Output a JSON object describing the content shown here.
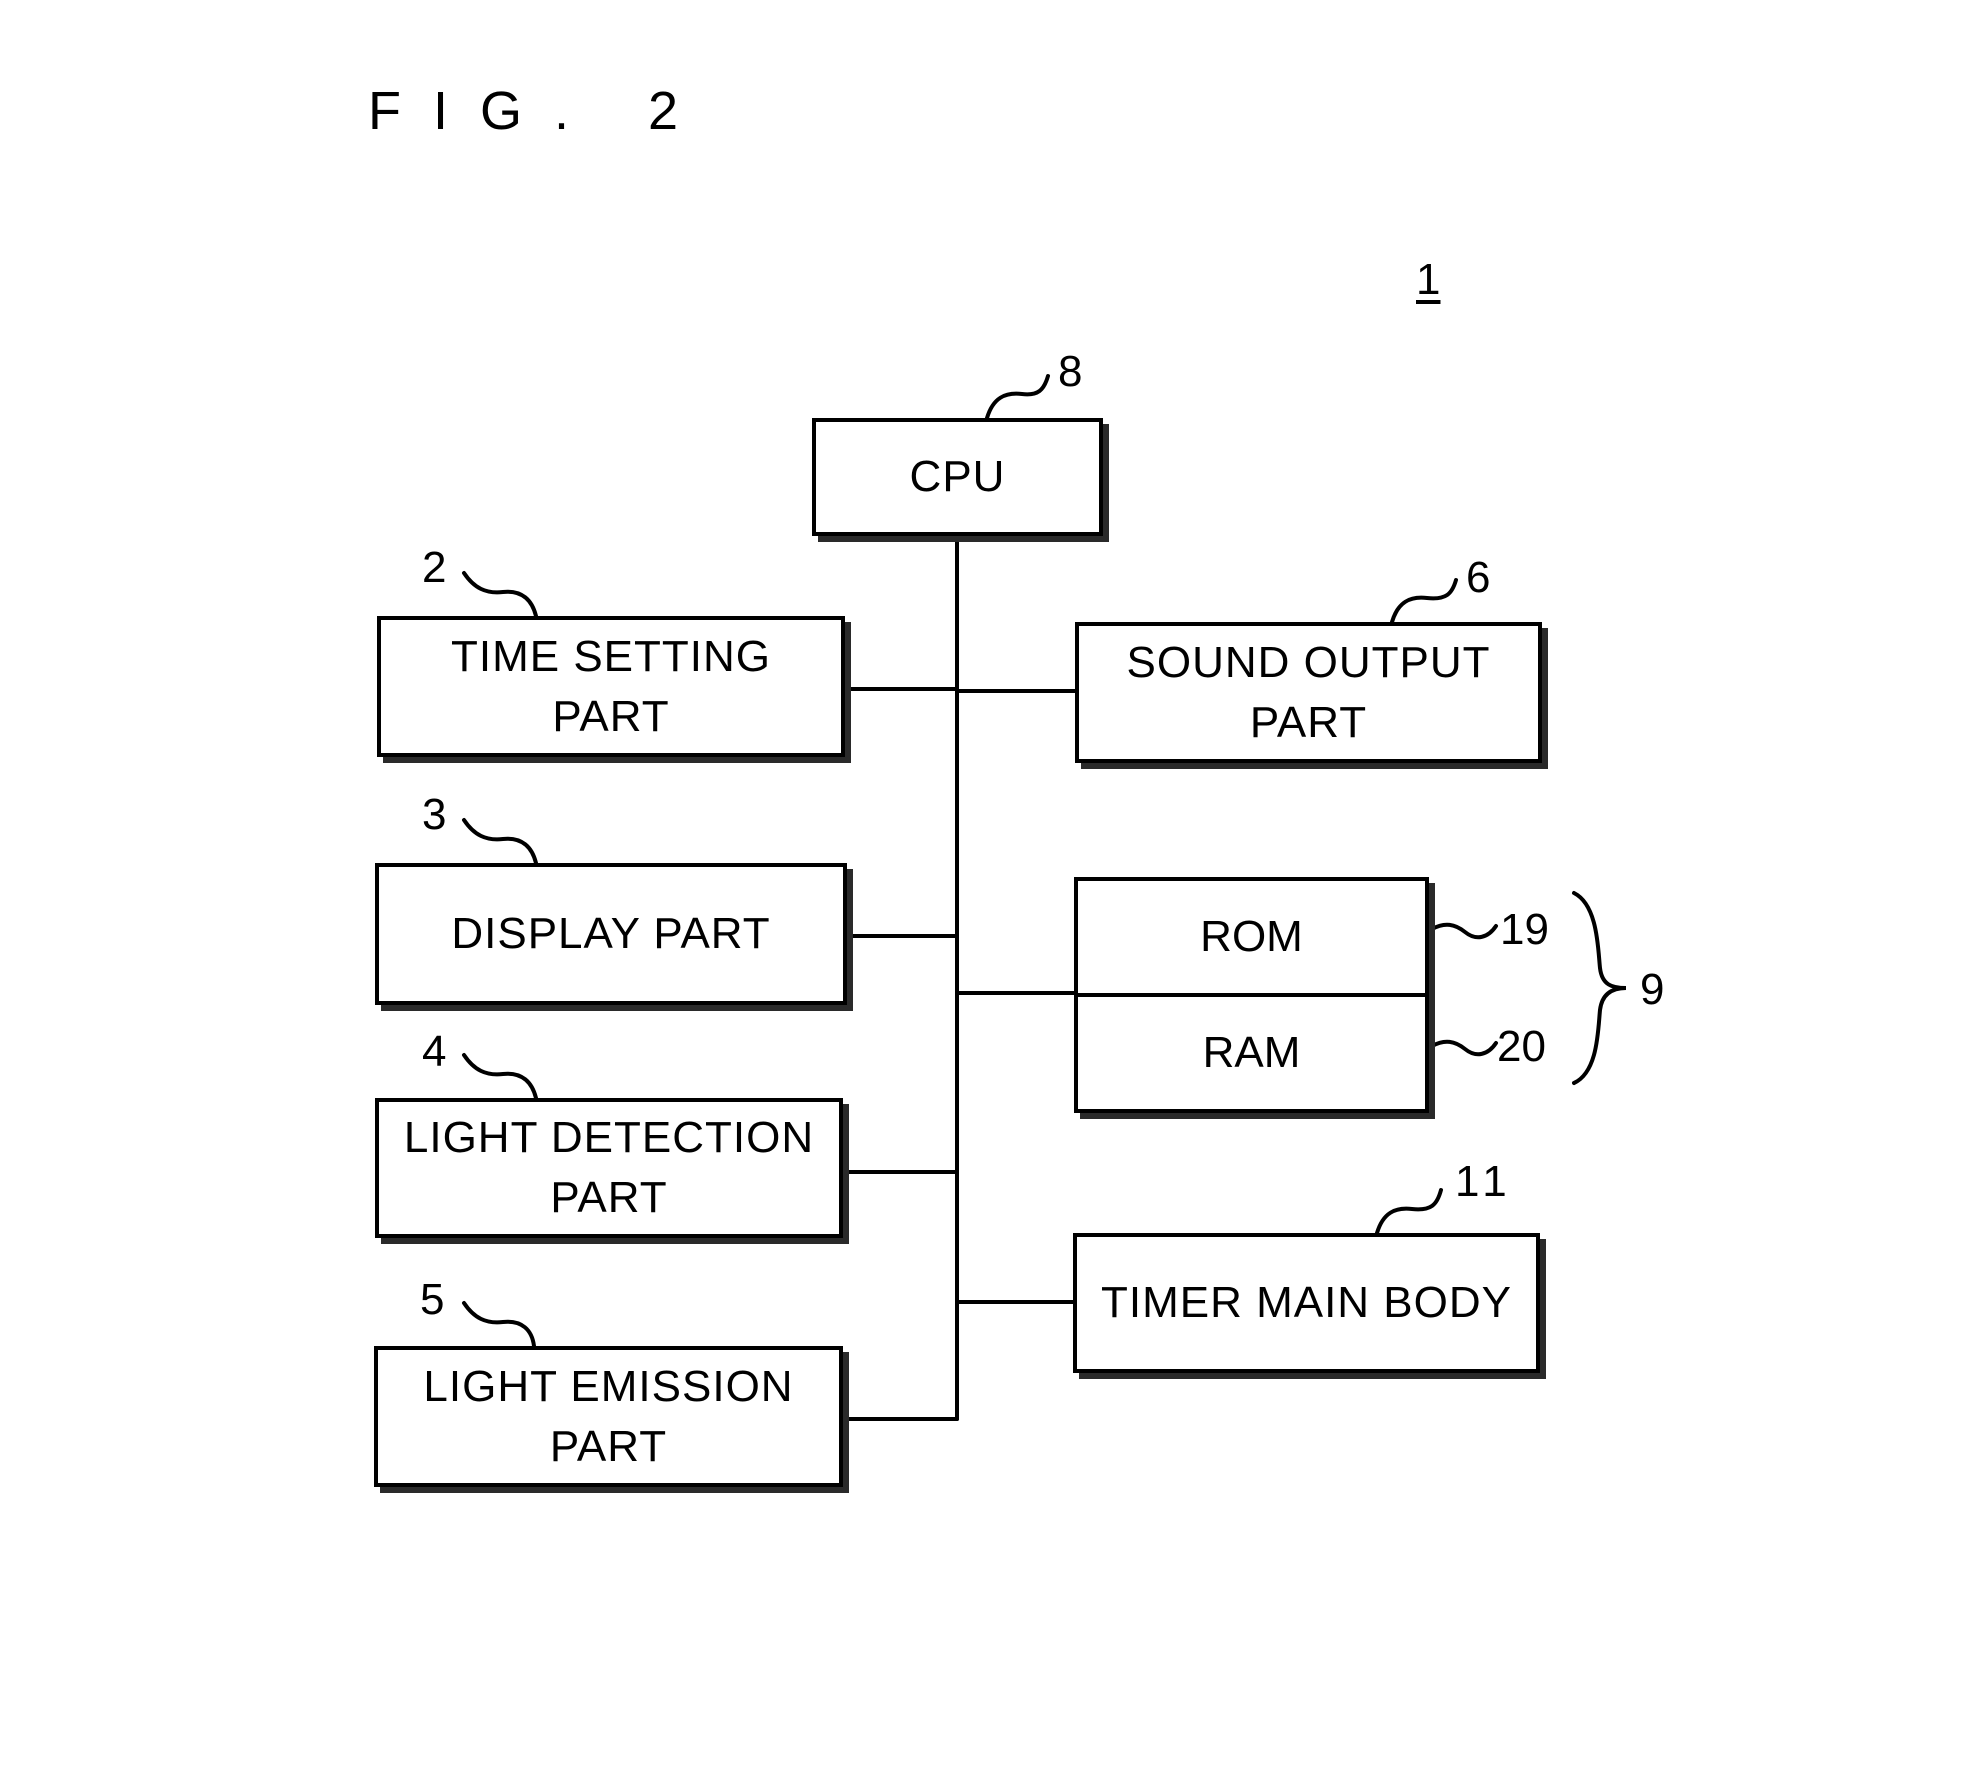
{
  "figure": {
    "title": "FIG. 2",
    "device_ref": "1"
  },
  "blocks": {
    "cpu": {
      "label": "CPU",
      "ref": "8"
    },
    "time_setting": {
      "label_line1": "TIME SETTING",
      "label_line2": "PART",
      "ref": "2"
    },
    "display": {
      "label": "DISPLAY PART",
      "ref": "3"
    },
    "light_detection": {
      "label_line1": "LIGHT DETECTION",
      "label_line2": "PART",
      "ref": "4"
    },
    "light_emission": {
      "label_line1": "LIGHT EMISSION",
      "label_line2": "PART",
      "ref": "5"
    },
    "sound_output": {
      "label_line1": "SOUND OUTPUT",
      "label_line2": "PART",
      "ref": "6"
    },
    "memory": {
      "ref": "9",
      "rom": {
        "label": "ROM",
        "ref": "19"
      },
      "ram": {
        "label": "RAM",
        "ref": "20"
      }
    },
    "timer_main_body": {
      "label": "TIMER MAIN BODY",
      "ref": "11"
    }
  },
  "connections": [
    {
      "from": "cpu",
      "to": "bus"
    },
    {
      "from": "time_setting",
      "to": "bus"
    },
    {
      "from": "sound_output",
      "to": "bus"
    },
    {
      "from": "display",
      "to": "bus"
    },
    {
      "from": "memory",
      "to": "bus"
    },
    {
      "from": "light_detection",
      "to": "bus"
    },
    {
      "from": "timer_main_body",
      "to": "bus"
    },
    {
      "from": "light_emission",
      "to": "bus"
    }
  ]
}
